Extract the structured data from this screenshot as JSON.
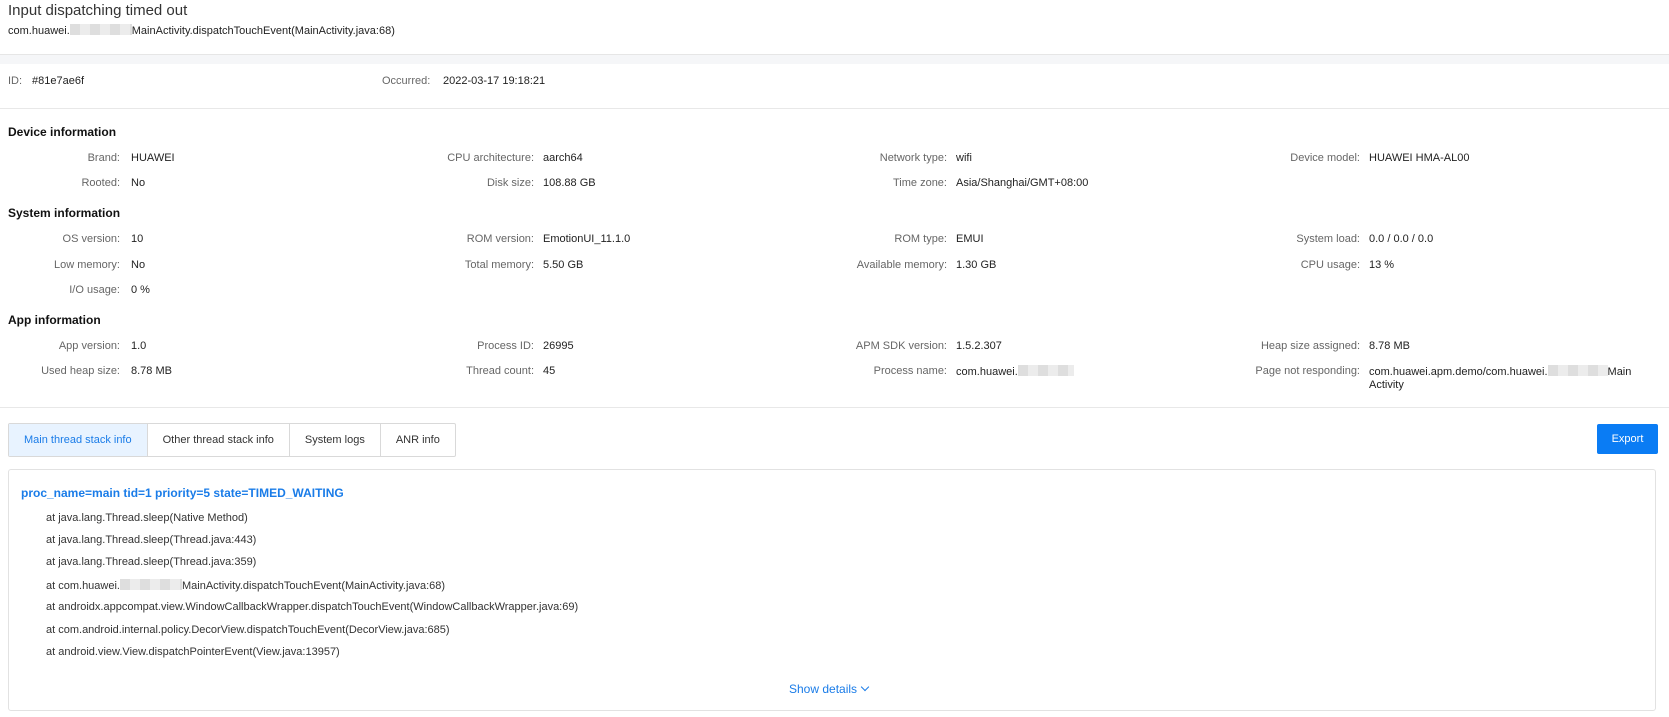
{
  "header": {
    "title": "Input dispatching timed out",
    "subtitle_pre": "com.huawei.",
    "subtitle_post": "MainActivity.dispatchTouchEvent(MainActivity.java:68)"
  },
  "meta": {
    "id_label": "ID:",
    "id_value": "#81e7ae6f",
    "occurred_label": "Occurred:",
    "occurred_value": "2022-03-17 19:18:21"
  },
  "device": {
    "title": "Device information",
    "brand_label": "Brand:",
    "brand_value": "HUAWEI",
    "cpu_arch_label": "CPU architecture:",
    "cpu_arch_value": "aarch64",
    "network_label": "Network type:",
    "network_value": "wifi",
    "model_label": "Device model:",
    "model_value": "HUAWEI HMA-AL00",
    "rooted_label": "Rooted:",
    "rooted_value": "No",
    "disk_label": "Disk size:",
    "disk_value": "108.88 GB",
    "timezone_label": "Time zone:",
    "timezone_value": "Asia/Shanghai/GMT+08:00"
  },
  "system": {
    "title": "System information",
    "os_label": "OS version:",
    "os_value": "10",
    "rom_version_label": "ROM version:",
    "rom_version_value": "EmotionUI_11.1.0",
    "rom_type_label": "ROM type:",
    "rom_type_value": "EMUI",
    "load_label": "System load:",
    "load_value": "0.0 / 0.0 / 0.0",
    "low_memory_label": "Low memory:",
    "low_memory_value": "No",
    "total_memory_label": "Total memory:",
    "total_memory_value": "5.50 GB",
    "avail_memory_label": "Available memory:",
    "avail_memory_value": "1.30 GB",
    "cpu_usage_label": "CPU usage:",
    "cpu_usage_value": "13 %",
    "io_label": "I/O usage:",
    "io_value": "0 %"
  },
  "app": {
    "title": "App information",
    "app_version_label": "App version:",
    "app_version_value": "1.0",
    "process_id_label": "Process ID:",
    "process_id_value": "26995",
    "sdk_label": "APM SDK version:",
    "sdk_value": "1.5.2.307",
    "heap_assigned_label": "Heap size assigned:",
    "heap_assigned_value": "8.78 MB",
    "used_heap_label": "Used heap size:",
    "used_heap_value": "8.78 MB",
    "thread_count_label": "Thread count:",
    "thread_count_value": "45",
    "process_name_label": "Process name:",
    "process_name_value": "com.huawei.",
    "page_label": "Page not responding:",
    "page_value_pre": "com.huawei.apm.demo/com.huawei.",
    "page_value_post": "Main",
    "page_value_line2": "Activity"
  },
  "tabs": [
    {
      "label": "Main thread stack info"
    },
    {
      "label": "Other thread stack info"
    },
    {
      "label": "System logs"
    },
    {
      "label": "ANR info"
    }
  ],
  "export_label": "Export",
  "stack": {
    "header": "proc_name=main tid=1 priority=5 state=TIMED_WAITING",
    "frames": [
      "at java.lang.Thread.sleep(Native Method)",
      "at java.lang.Thread.sleep(Thread.java:443)",
      "at java.lang.Thread.sleep(Thread.java:359)",
      "at com.huawei.",
      "at androidx.appcompat.view.WindowCallbackWrapper.dispatchTouchEvent(WindowCallbackWrapper.java:69)",
      "at com.android.internal.policy.DecorView.dispatchTouchEvent(DecorView.java:685)",
      "at android.view.View.dispatchPointerEvent(View.java:13957)"
    ],
    "frame4_post": "MainActivity.dispatchTouchEvent(MainActivity.java:68)",
    "show_details": "Show details"
  }
}
